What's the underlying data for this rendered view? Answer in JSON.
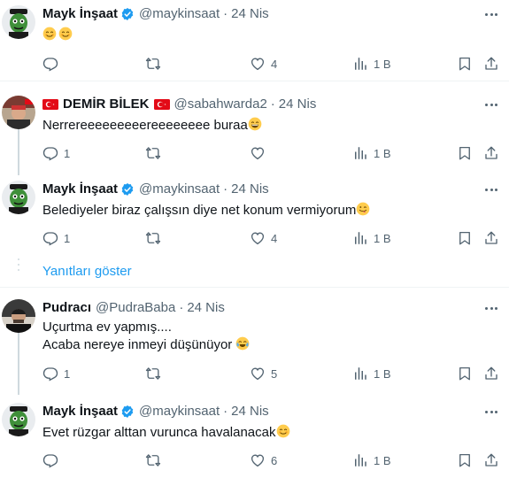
{
  "tweets": [
    {
      "name": "Mayk İnşaat",
      "handle": "@maykinsaat",
      "date": "24 Nis",
      "verified": true,
      "line1": "",
      "line2": "",
      "actions": {
        "reply": "",
        "repost": "",
        "like": "4",
        "views": "1 B"
      }
    },
    {
      "name": "DEMİR BİLEK",
      "handle": "@sabahwarda2",
      "date": "24 Nis",
      "verified": false,
      "line1": "Nerrereeeeeeeeereeeeeeee buraa",
      "line2": "",
      "actions": {
        "reply": "1",
        "repost": "",
        "like": "",
        "views": "1 B"
      }
    },
    {
      "name": "Mayk İnşaat",
      "handle": "@maykinsaat",
      "date": "24 Nis",
      "verified": true,
      "line1": "Belediyeler biraz çalışsın diye net konum vermiyorum",
      "line2": "",
      "actions": {
        "reply": "1",
        "repost": "",
        "like": "4",
        "views": "1 B"
      }
    },
    {
      "name": "Pudracı",
      "handle": "@PudraBaba",
      "date": "24 Nis",
      "verified": false,
      "line1": "Uçurtma ev yapmış....",
      "line2": "Acaba nereye inmeyi düşünüyor",
      "actions": {
        "reply": "1",
        "repost": "",
        "like": "5",
        "views": "1 B"
      }
    },
    {
      "name": "Mayk İnşaat",
      "handle": "@maykinsaat",
      "date": "24 Nis",
      "verified": true,
      "line1": "Evet rüzgar alttan vurunca havalanacak",
      "line2": "",
      "actions": {
        "reply": "",
        "repost": "",
        "like": "6",
        "views": "1 B"
      }
    }
  ],
  "show_replies_label": "Yanıtları göster",
  "icons": [
    "reply-icon",
    "repost-icon",
    "like-icon",
    "views-icon",
    "bookmark-icon",
    "share-icon",
    "verified-icon",
    "more-icon"
  ],
  "colors": {
    "accent": "#1d9bf0",
    "secondary_text": "#536471",
    "divider": "#eff3f4",
    "thread_line": "#cfd9de"
  }
}
